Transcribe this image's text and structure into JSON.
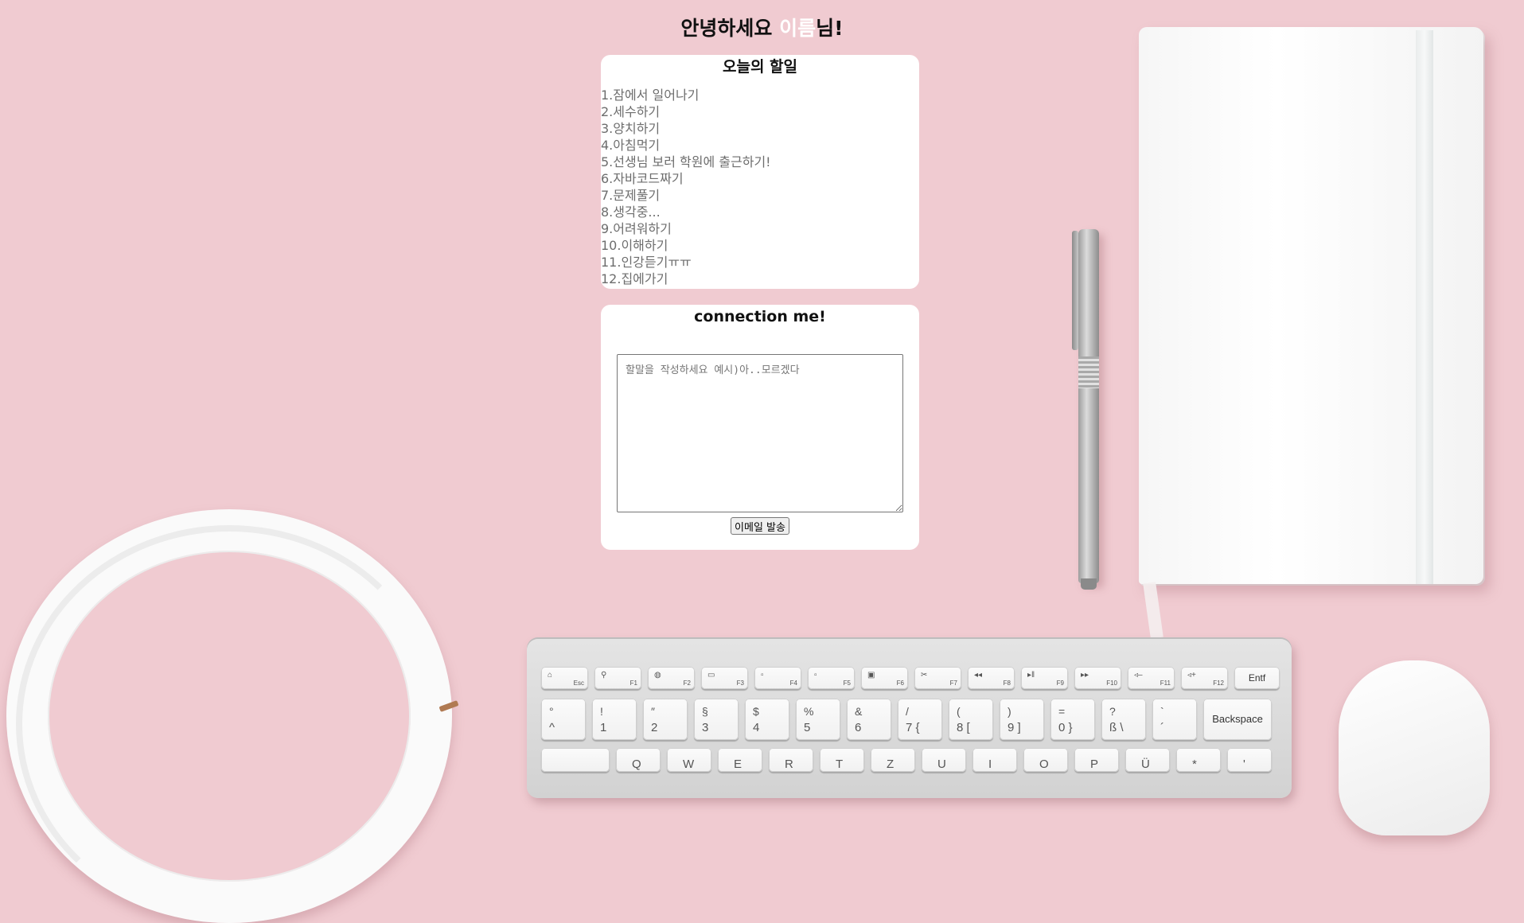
{
  "greeting": {
    "prefix": "안녕하세요 ",
    "name": "이름",
    "suffix": "님!"
  },
  "todo": {
    "title": "오늘의 할일",
    "items": [
      "1.잠에서 일어나기",
      "2.세수하기",
      "3.양치하기",
      "4.아침먹기",
      "5.선생님 보러 학원에 출근하기!",
      "6.자바코드짜기",
      "7.문제풀기",
      "8.생각중...",
      "9.어려워하기",
      "10.이해하기",
      "11.인강듣기ㅠㅠ",
      "12.집에가기"
    ]
  },
  "contact": {
    "title": "connection me!",
    "message_placeholder": "할말을 작성하세요 예시)아..모르겠다",
    "message_value": "",
    "send_label": "이메일 발송"
  },
  "keyboard": {
    "function_row": [
      {
        "label": "Esc"
      },
      {
        "label": "F1"
      },
      {
        "label": "F2"
      },
      {
        "label": "F3"
      },
      {
        "label": "F4"
      },
      {
        "label": "F5"
      },
      {
        "label": "F6"
      },
      {
        "label": "F7"
      },
      {
        "label": "F8"
      },
      {
        "label": "F9"
      },
      {
        "label": "F10"
      },
      {
        "label": "F11"
      },
      {
        "label": "F12"
      }
    ],
    "entf": "Entf",
    "number_row": [
      {
        "top": "°",
        "bottom": "^"
      },
      {
        "top": "!",
        "bottom": "1"
      },
      {
        "top": "″",
        "bottom": "2"
      },
      {
        "top": "§",
        "bottom": "3"
      },
      {
        "top": "$",
        "bottom": "4"
      },
      {
        "top": "%",
        "bottom": "5"
      },
      {
        "top": "&",
        "bottom": "6"
      },
      {
        "top": "/",
        "bottom": "7 {"
      },
      {
        "top": "(",
        "bottom": "8 ["
      },
      {
        "top": ")",
        "bottom": "9 ]"
      },
      {
        "top": "=",
        "bottom": "0 }"
      },
      {
        "top": "?",
        "bottom": "ß \\"
      },
      {
        "top": "`",
        "bottom": "´"
      }
    ],
    "backspace": "Backspace",
    "letter_row": [
      "Q",
      "W",
      "E",
      "R",
      "T",
      "Z",
      "U",
      "I",
      "O",
      "P",
      "Ü",
      "*",
      "'"
    ]
  },
  "colors": {
    "background": "#f0cbd1",
    "card": "#ffffff",
    "name_highlight": "#ffffff",
    "todo_text": "#6d6d6d"
  }
}
